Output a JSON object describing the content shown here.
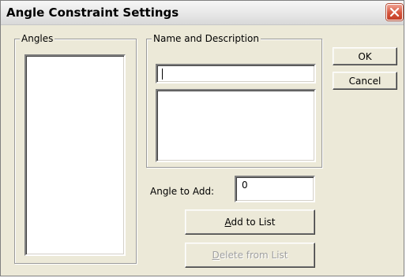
{
  "window": {
    "title": "Angle Constraint Settings",
    "close_label": "close"
  },
  "groups": {
    "angles": {
      "label": "Angles"
    },
    "name_description": {
      "label": "Name and Description"
    }
  },
  "fields": {
    "name_value": "",
    "description_value": "",
    "angle_to_add_label": "Angle to Add:",
    "angle_to_add_value": "0"
  },
  "buttons": {
    "ok": "OK",
    "cancel": "Cancel",
    "add_to_list": "Add to List",
    "delete_from_list": "Delete from List"
  },
  "colors": {
    "dialog_bg": "#ece9d8",
    "close_red": "#d5543c"
  }
}
